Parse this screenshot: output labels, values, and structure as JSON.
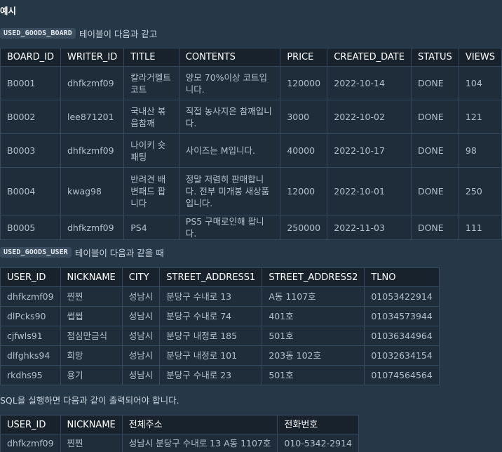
{
  "section_title": "예시",
  "board_caption": {
    "table_name": "USED_GOODS_BOARD",
    "text": "테이블이 다음과 같고"
  },
  "board_table": {
    "headers": [
      "BOARD_ID",
      "WRITER_ID",
      "TITLE",
      "CONTENTS",
      "PRICE",
      "CREATED_DATE",
      "STATUS",
      "VIEWS"
    ],
    "rows": [
      [
        "B0001",
        "dhfkzmf09",
        "칼라거펠트 코트",
        "양모 70%이상 코트입니다.",
        "120000",
        "2022-10-14",
        "DONE",
        "104"
      ],
      [
        "B0002",
        "lee871201",
        "국내산 볶음참깨",
        "직접 농사지은 참깨입니다.",
        "3000",
        "2022-10-02",
        "DONE",
        "121"
      ],
      [
        "B0003",
        "dhfkzmf09",
        "나이키 숏패팅",
        "사이즈는 M입니다.",
        "40000",
        "2022-10-17",
        "DONE",
        "98"
      ],
      [
        "B0004",
        "kwag98",
        "반려견 배변패드 팝니다",
        "정말 저렴히 판매합니다. 전부 미개봉 새상품입니다.",
        "12000",
        "2022-10-01",
        "DONE",
        "250"
      ],
      [
        "B0005",
        "dhfkzmf09",
        "PS4",
        "PS5 구매로인해 팝니다.",
        "250000",
        "2022-11-03",
        "DONE",
        "111"
      ]
    ]
  },
  "user_caption": {
    "table_name": "USED_GOODS_USER",
    "text": "테이블이 다음과 같을 때"
  },
  "user_table": {
    "headers": [
      "USER_ID",
      "NICKNAME",
      "CITY",
      "STREET_ADDRESS1",
      "STREET_ADDRESS2",
      "TLNO"
    ],
    "rows": [
      [
        "dhfkzmf09",
        "찐찐",
        "성남시",
        "분당구 수내로 13",
        "A동 1107호",
        "01053422914"
      ],
      [
        "dlPcks90",
        "썹썹",
        "성남시",
        "분당구 수내로 74",
        "401호",
        "01034573944"
      ],
      [
        "cjfwls91",
        "점심만금식",
        "성남시",
        "분당구 내정로 185",
        "501호",
        "01036344964"
      ],
      [
        "dlfghks94",
        "희망",
        "성남시",
        "분당구 내정로 101",
        "203동 102호",
        "01032634154"
      ],
      [
        "rkdhs95",
        "용기",
        "성남시",
        "분당구 수내로 23",
        "501호",
        "01074564564"
      ]
    ]
  },
  "result_caption": "SQL을 실행하면 다음과 같이 출력되어야 합니다.",
  "result_table": {
    "headers": [
      "USER_ID",
      "NICKNAME",
      "전체주소",
      "전화번호"
    ],
    "rows": [
      [
        "dhfkzmf09",
        "찐찐",
        "성남시 분당구 수내로 13 A동 1107호",
        "010-5342-2914"
      ]
    ]
  }
}
